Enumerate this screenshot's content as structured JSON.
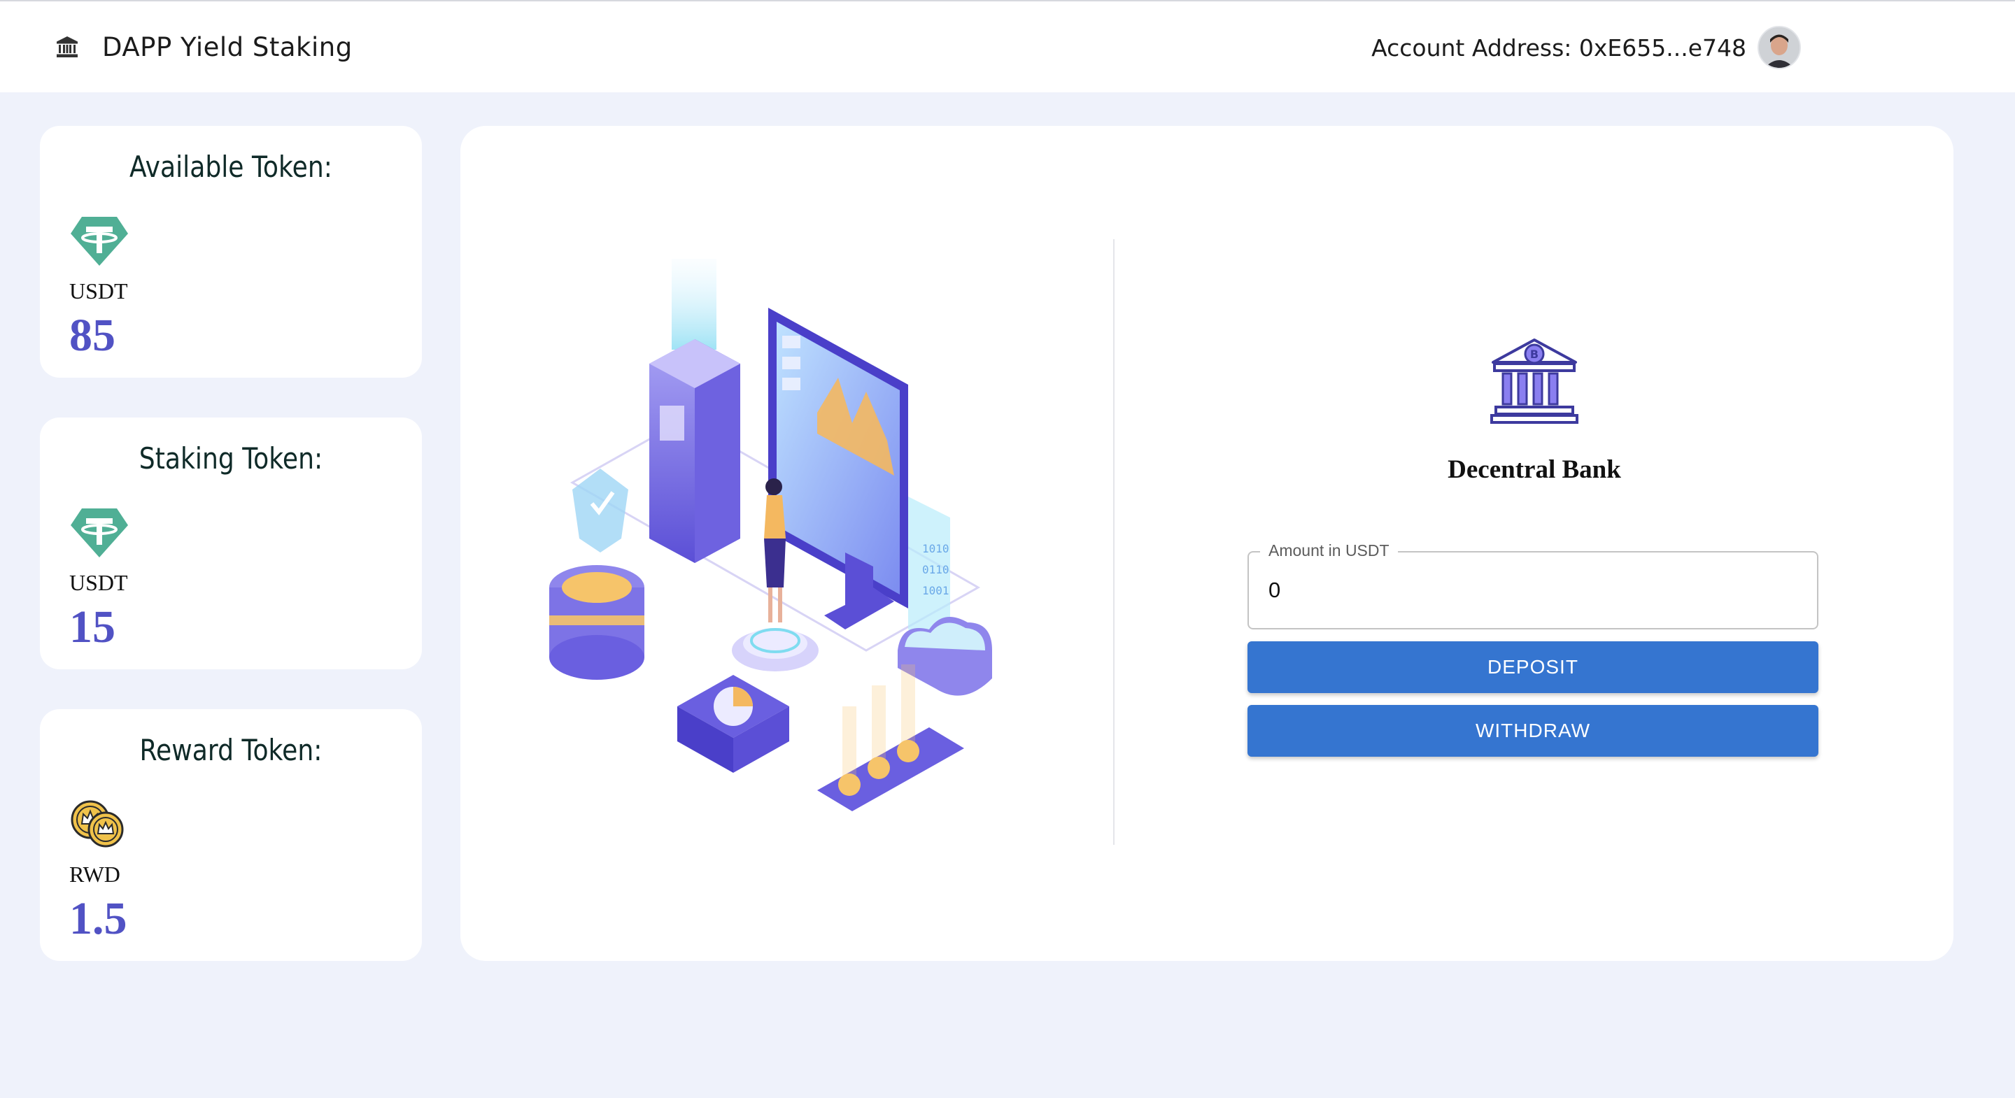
{
  "header": {
    "app_title": "DAPP Yield Staking",
    "account_label": "Account Address: 0xE655...e748",
    "brand_icon": "bank-building-icon"
  },
  "cards": [
    {
      "title": "Available Token:",
      "symbol": "USDT",
      "value": "85",
      "icon": "tether-icon"
    },
    {
      "title": "Staking Token:",
      "symbol": "USDT",
      "value": "15",
      "icon": "tether-icon"
    },
    {
      "title": "Reward Token:",
      "symbol": "RWD",
      "value": "1.5",
      "icon": "reward-coins-icon"
    }
  ],
  "bank": {
    "title": "Decentral Bank",
    "icon": "bitcoin-bank-icon",
    "amount_label": "Amount in USDT",
    "amount_value": "0",
    "deposit_label": "DEPOSIT",
    "withdraw_label": "WITHDRAW"
  },
  "colors": {
    "accent_button": "#3575d0",
    "value_text": "#5152c4",
    "tether_green": "#50af95",
    "page_bg": "#eff2fb"
  }
}
